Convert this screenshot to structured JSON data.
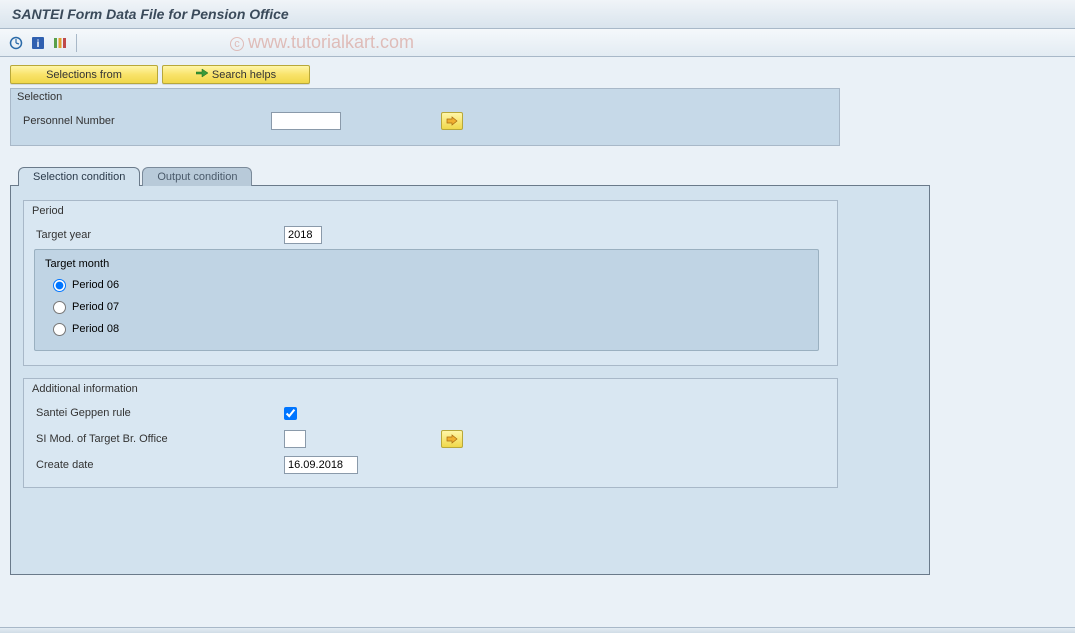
{
  "title": "SANTEI Form Data File for Pension Office",
  "watermark": "www.tutorialkart.com",
  "buttons": {
    "selections_from": "Selections from",
    "search_helps": "Search helps"
  },
  "selection_box": {
    "legend": "Selection",
    "personnel_label": "Personnel Number",
    "personnel_value": ""
  },
  "tabs": {
    "active": "Selection condition",
    "inactive": "Output condition"
  },
  "period_box": {
    "legend": "Period",
    "target_year_label": "Target year",
    "target_year_value": "2018",
    "target_month_legend": "Target month",
    "options": {
      "p06": "Period 06",
      "p07": "Period 07",
      "p08": "Period 08"
    },
    "selected": "p06"
  },
  "additional_box": {
    "legend": "Additional information",
    "rule_label": "Santei Geppen rule",
    "rule_checked": true,
    "si_label": "SI Mod. of Target Br. Office",
    "si_value": "",
    "create_label": "Create date",
    "create_value": "16.09.2018"
  }
}
